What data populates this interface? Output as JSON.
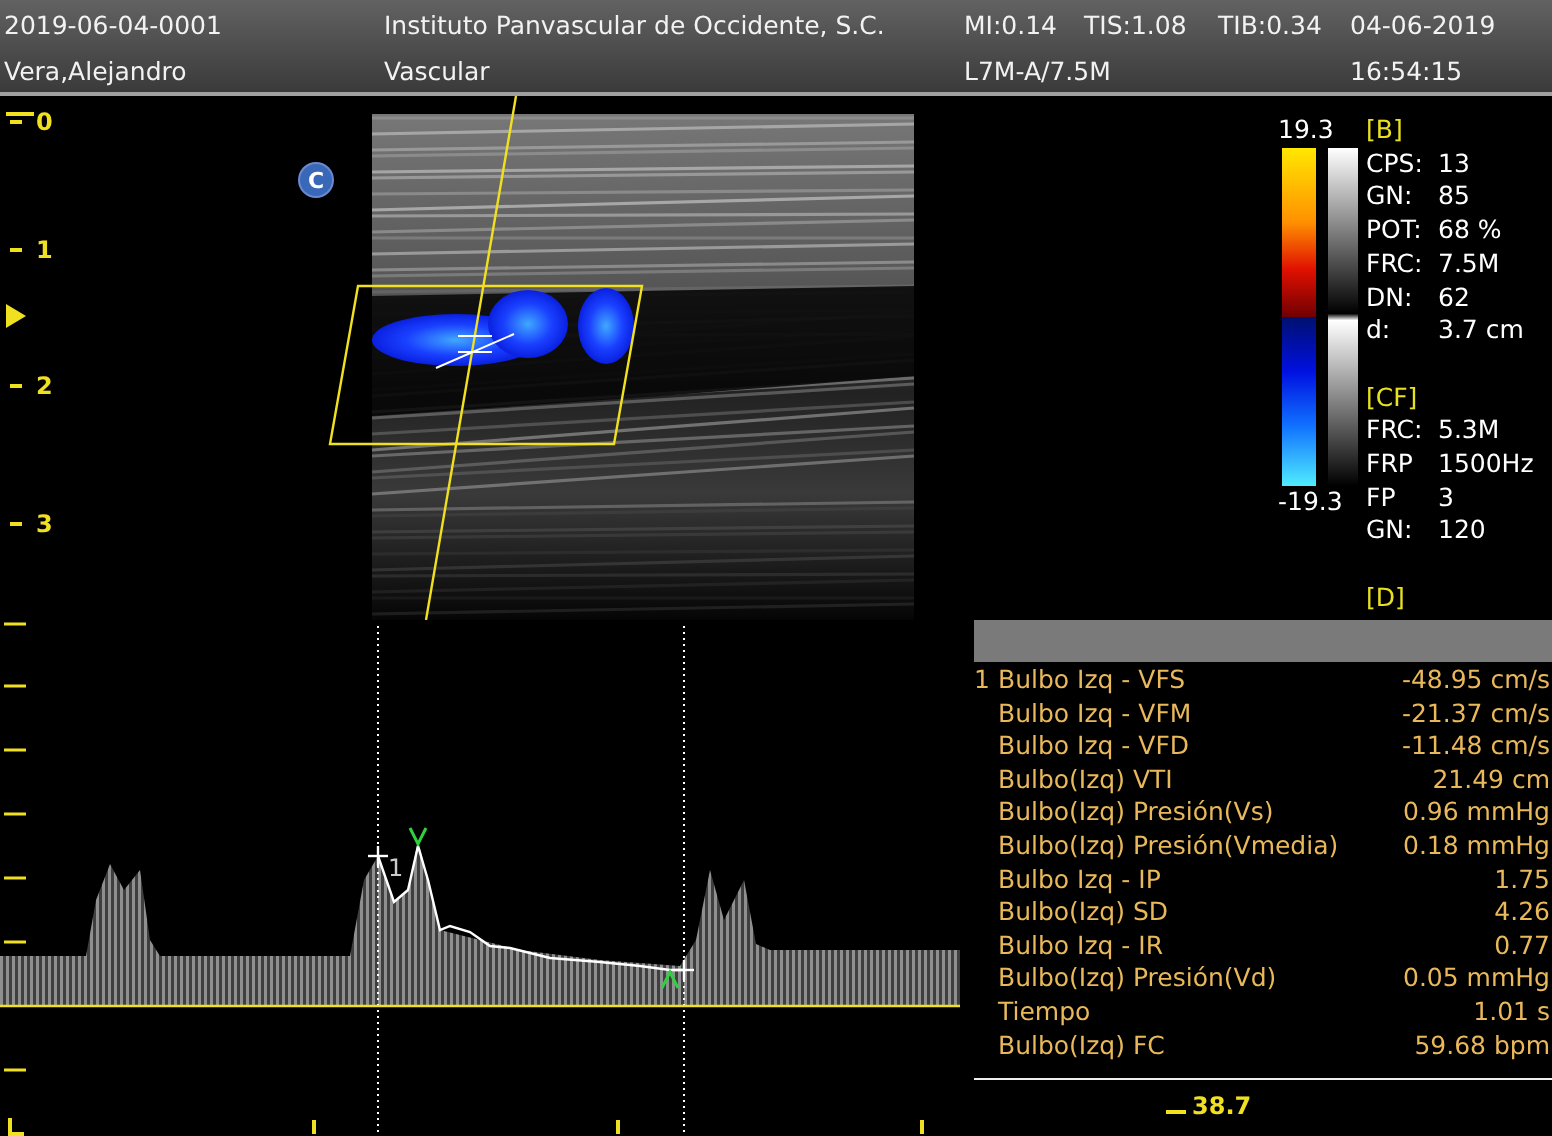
{
  "header": {
    "patient_id": "2019-06-04-0001",
    "institution": "Instituto Panvascular de Occidente, S.C.",
    "mi": "MI:0.14",
    "tis": "TIS:1.08",
    "tib": "TIB:0.34",
    "date": "04-06-2019",
    "patient_name": "Vera,Alejandro",
    "preset": "Vascular",
    "probe": "L7M-A/7.5M",
    "time": "16:54:15"
  },
  "image": {
    "badge": "C",
    "depth_scale": [
      "0",
      "1",
      "2",
      "3"
    ]
  },
  "colorbar": {
    "max": "19.3",
    "min": "-19.3"
  },
  "parameters": [
    {
      "heading": "[B]",
      "items": [
        {
          "label": "CPS:",
          "value": "13"
        },
        {
          "label": "GN:",
          "value": "85"
        },
        {
          "label": "POT:",
          "value": "68 %"
        },
        {
          "label": "FRC:",
          "value": "7.5M"
        },
        {
          "label": "DN:",
          "value": "62"
        },
        {
          "label": "d:",
          "value": "3.7 cm"
        }
      ]
    },
    {
      "heading": "[CF]",
      "items": [
        {
          "label": "FRC:",
          "value": "5.3M"
        },
        {
          "label": "FRP",
          "value": "1500Hz"
        },
        {
          "label": "FP",
          "value": "3"
        },
        {
          "label": "GN:",
          "value": "120"
        }
      ]
    },
    {
      "heading": "[D]"
    }
  ],
  "doppler": {
    "trace_label": "1",
    "scale_readout": "38.7"
  },
  "measurements": [
    {
      "index": "1",
      "label": "Bulbo Izq - VFS",
      "value": "-48.95 cm/s"
    },
    {
      "label": "Bulbo Izq - VFM",
      "value": "-21.37 cm/s"
    },
    {
      "label": "Bulbo Izq - VFD",
      "value": "-11.48 cm/s"
    },
    {
      "label": "Bulbo(Izq) VTI",
      "value": "21.49 cm"
    },
    {
      "label": "Bulbo(Izq) Presión(Vs)",
      "value": "0.96 mmHg"
    },
    {
      "label": "Bulbo(Izq) Presión(Vmedia)",
      "value": "0.18 mmHg"
    },
    {
      "label": "Bulbo Izq - IP",
      "value": "1.75"
    },
    {
      "label": "Bulbo(Izq) SD",
      "value": "4.26"
    },
    {
      "label": "Bulbo Izq - IR",
      "value": "0.77"
    },
    {
      "label": "Bulbo(Izq) Presión(Vd)",
      "value": "0.05 mmHg"
    },
    {
      "label": "Tiempo",
      "value": "1.01 s"
    },
    {
      "label": "Bulbo(Izq) FC",
      "value": "59.68 bpm"
    }
  ]
}
